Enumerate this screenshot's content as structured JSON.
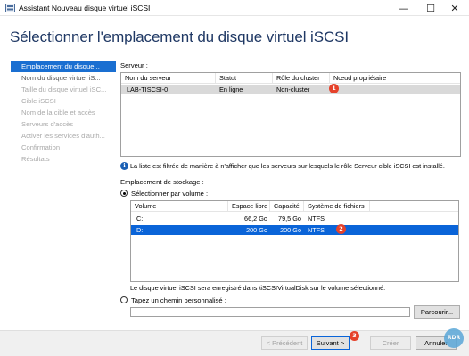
{
  "window": {
    "title": "Assistant Nouveau disque virtuel iSCSI",
    "min_glyph": "—",
    "max_glyph": "☐",
    "close_glyph": "✕"
  },
  "page_title": "Sélectionner l'emplacement du disque virtuel iSCSI",
  "nav": {
    "items": [
      {
        "label": "Emplacement du disque...",
        "state": "active"
      },
      {
        "label": "Nom du disque virtuel iS...",
        "state": "enabled"
      },
      {
        "label": "Taille du disque virtuel iSC...",
        "state": "disabled"
      },
      {
        "label": "Cible iSCSI",
        "state": "disabled"
      },
      {
        "label": "Nom de la cible et accès",
        "state": "disabled"
      },
      {
        "label": "Serveurs d'accès",
        "state": "disabled"
      },
      {
        "label": "Activer les services d'auth...",
        "state": "disabled"
      },
      {
        "label": "Confirmation",
        "state": "disabled"
      },
      {
        "label": "Résultats",
        "state": "disabled"
      }
    ]
  },
  "server_section": {
    "label": "Serveur :",
    "columns": [
      "Nom du serveur",
      "Statut",
      "Rôle du cluster",
      "Nœud propriétaire"
    ],
    "rows": [
      {
        "name": "LAB-TISCSI-0",
        "status": "En ligne",
        "role": "Non-cluster",
        "owner": ""
      }
    ],
    "badge": "1"
  },
  "info_text": "La liste est filtrée de manière à n'afficher que les serveurs sur lesquels le rôle Serveur cible iSCSI est installé.",
  "storage": {
    "label": "Emplacement de stockage :",
    "by_volume_label": "Sélectionner par volume :",
    "by_volume_selected": true,
    "columns": [
      "Volume",
      "Espace libre",
      "Capacité",
      "Système de fichiers"
    ],
    "rows": [
      {
        "volume": "C:",
        "free": "66,2 Go",
        "capacity": "79,5 Go",
        "fs": "NTFS"
      },
      {
        "volume": "D:",
        "free": "200 Go",
        "capacity": "200 Go",
        "fs": "NTFS"
      }
    ],
    "badge": "2",
    "note": "Le disque virtuel iSCSI sera enregistré dans \\iSCSIVirtualDisk sur le volume sélectionné.",
    "custom_path_label": "Tapez un chemin personnalisé :",
    "custom_path_value": "",
    "browse_label": "Parcourir..."
  },
  "footer": {
    "prev_label": "< Précédent",
    "next_label": "Suivant >",
    "create_label": "Créer",
    "cancel_label": "Annuler",
    "badge": "3"
  },
  "watermark": "RDR",
  "colors": {
    "accent": "#1a6fd1",
    "title": "#1f3864",
    "badge": "#e5422b"
  }
}
